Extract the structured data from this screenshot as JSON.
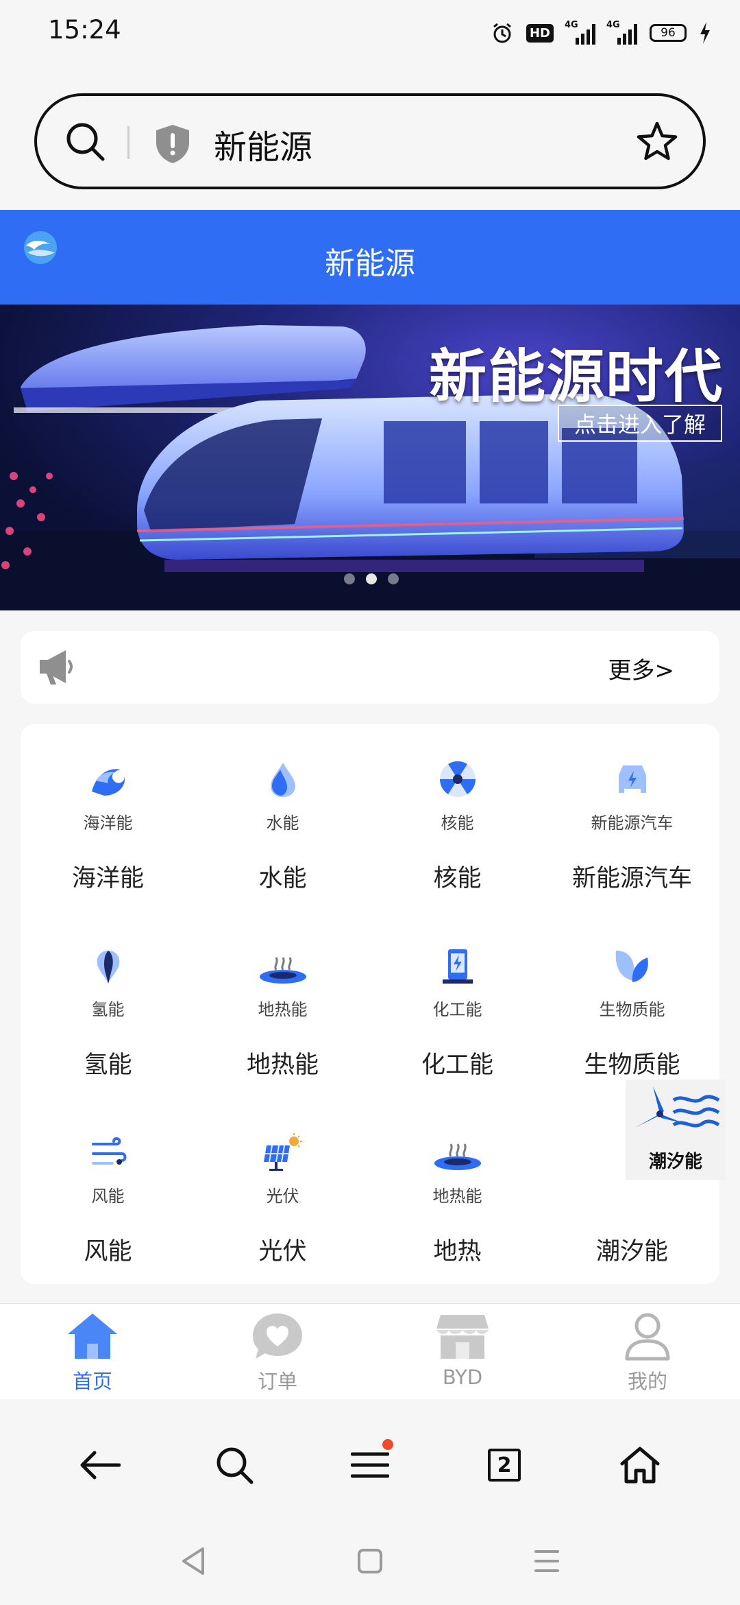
{
  "status_bar": {
    "time": "15:24",
    "hd": "HD",
    "signal1": "4G",
    "signal2": "4G",
    "battery": "96"
  },
  "search_bar": {
    "query": "新能源",
    "icons": [
      "search-icon",
      "shield-icon",
      "star-icon"
    ]
  },
  "header": {
    "title": "新能源"
  },
  "banner": {
    "headline": "新能源时代",
    "cta": "点击进入了解",
    "slides": 3,
    "active_slide": 2
  },
  "notice": {
    "more": "更多>"
  },
  "categories": [
    {
      "small": "海洋能",
      "label": "海洋能",
      "icon": "ocean-wave-icon"
    },
    {
      "small": "水能",
      "label": "水能",
      "icon": "water-drop-icon"
    },
    {
      "small": "核能",
      "label": "核能",
      "icon": "nuclear-icon"
    },
    {
      "small": "新能源汽车",
      "label": "新能源汽车",
      "icon": "ev-car-icon"
    },
    {
      "small": "氢能",
      "label": "氢能",
      "icon": "hydrogen-icon"
    },
    {
      "small": "地热能",
      "label": "地热能",
      "icon": "geothermal-icon"
    },
    {
      "small": "化工能",
      "label": "化工能",
      "icon": "chemical-icon"
    },
    {
      "small": "生物质能",
      "label": "生物质能",
      "icon": "leaf-icon"
    },
    {
      "small": "风能",
      "label": "风能",
      "icon": "wind-icon"
    },
    {
      "small": "光伏",
      "label": "光伏",
      "icon": "solar-panel-icon"
    },
    {
      "small": "地热能",
      "label": "地热",
      "icon": "geothermal-icon"
    },
    {
      "small": "潮汐能",
      "label": "潮汐能",
      "icon": "tidal-image"
    }
  ],
  "tabs": [
    {
      "label": "首页",
      "icon": "home-icon",
      "active": true
    },
    {
      "label": "订单",
      "icon": "heart-chat-icon",
      "active": false
    },
    {
      "label": "BYD",
      "icon": "store-icon",
      "active": false
    },
    {
      "label": "我的",
      "icon": "user-icon",
      "active": false
    }
  ],
  "browser_bar": {
    "tab_count": "2"
  },
  "colors": {
    "primary": "#2f6df5",
    "background": "#f6f6f6",
    "notification_dot": "#f04a2a"
  }
}
